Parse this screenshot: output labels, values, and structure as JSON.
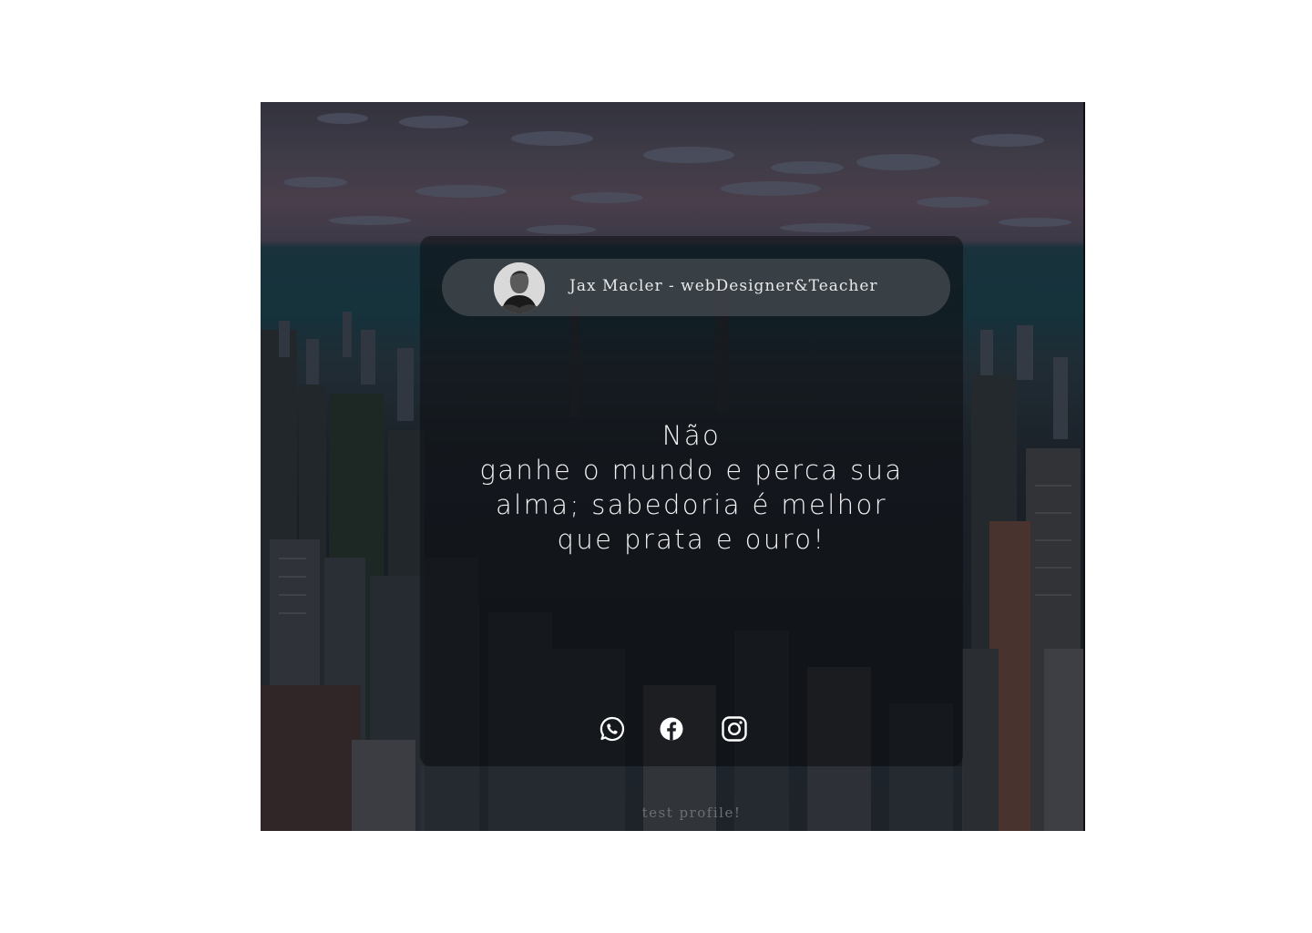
{
  "profile": {
    "name": "Jax Macler - webDesigner&Teacher"
  },
  "quote": {
    "lines": [
      "Não",
      "ganhe o mundo e perca sua",
      "alma; sabedoria é melhor",
      "que prata e ouro!"
    ]
  },
  "socials": [
    {
      "icon": "whatsapp-icon"
    },
    {
      "icon": "facebook-icon"
    },
    {
      "icon": "instagram-icon"
    }
  ],
  "footer": {
    "text": "test profile!"
  },
  "colors": {
    "card_bg": "#0c0e12",
    "text": "#f2f2f2",
    "footer_text": "#6b6f75"
  }
}
